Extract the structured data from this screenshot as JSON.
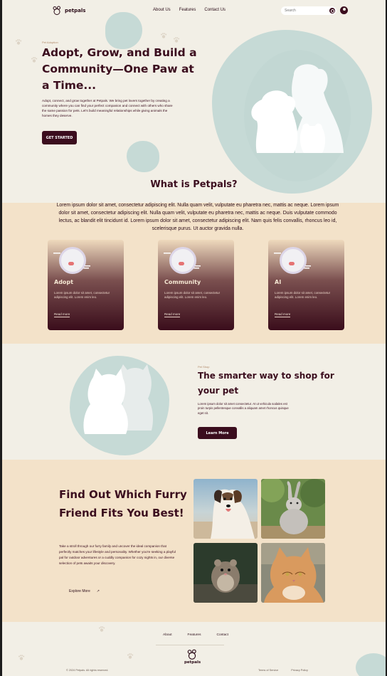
{
  "nav": {
    "logo_text": "petpals",
    "links": [
      "About Us",
      "Features",
      "Contact Us"
    ],
    "search_placeholder": "Search"
  },
  "hero": {
    "eyebrow": "Pet Adoption",
    "title": "Adopt, Grow, and Build a Community—One Paw at a Time...",
    "description": "Adopt, connect, and grow together at Petpals. We bring pet lovers together by creating a community where you can find your perfect companion and connect with others who share the same passion for pets. Let's build meaningful relationships while giving animals the homes they deserve.",
    "cta": "GET STARTED"
  },
  "what_is": {
    "title": "What is Petpals?",
    "body": "Lorem ipsum dolor sit amet, consectetur adipiscing elit. Nulla quam velit, vulputate eu pharetra nec, mattis ac neque. Lorem ipsum dolor sit amet, consectetur adipiscing elit. Nulla quam velit, vulputate eu pharetra nec, mattis ac neque. Duis vulputate commodo lectus, ac blandit elit tincidunt id. Lorem ipsum dolor sit amet, consectetur adipiscing elit. Nam quis felis convallis, rhoncus leo id, scelerisque purus. Ut auctor gravida nulla.",
    "cards": [
      {
        "title": "Adopt",
        "text": "Lorem ipsum dolor sit amet, consectetur adipiscing elit. Lorem enim leo.",
        "link": "Read more"
      },
      {
        "title": "Community",
        "text": "Lorem ipsum dolor sit amet, consectetur adipiscing elit. Lorem enim leo.",
        "link": "Read more"
      },
      {
        "title": "AI",
        "text": "Lorem ipsum dolor sit amet, consectetur adipiscing elit. Lorem enim leo.",
        "link": "Read more"
      }
    ]
  },
  "shop": {
    "eyebrow": "Pet Shop",
    "title": "The smarter way to shop for your pet",
    "description": "Lorem ipsum dolor sit amet consectetur. At ut vehicula sodales est proin turpis pellentesque convallis a aliquam amet rhoncus quisque eget sit.",
    "cta": "Learn More"
  },
  "find": {
    "title": "Find Out Which Furry Friend Fits You Best!",
    "description": "Take a stroll through our furry family and uncover the ideal companion that perfectly matches your lifestyle and personality. Whether you're seeking a playful pal for outdoor adventures or a cuddly companion for cozy nights in, our diverse selection of pets awaits your discovery.",
    "cta": "Explore More",
    "cta_arrow": "↗"
  },
  "footer": {
    "links": [
      "About",
      "Features",
      "Contact"
    ],
    "logo_text": "petpals",
    "copyright": "© 2024 Petpals. All rights reserved.",
    "legal": [
      "Terms of Service",
      "Privacy Policy"
    ]
  },
  "colors": {
    "primary": "#3b0d1e",
    "cream": "#f2efe6",
    "sand": "#f3e2c9",
    "sage": "#c6dad6"
  }
}
